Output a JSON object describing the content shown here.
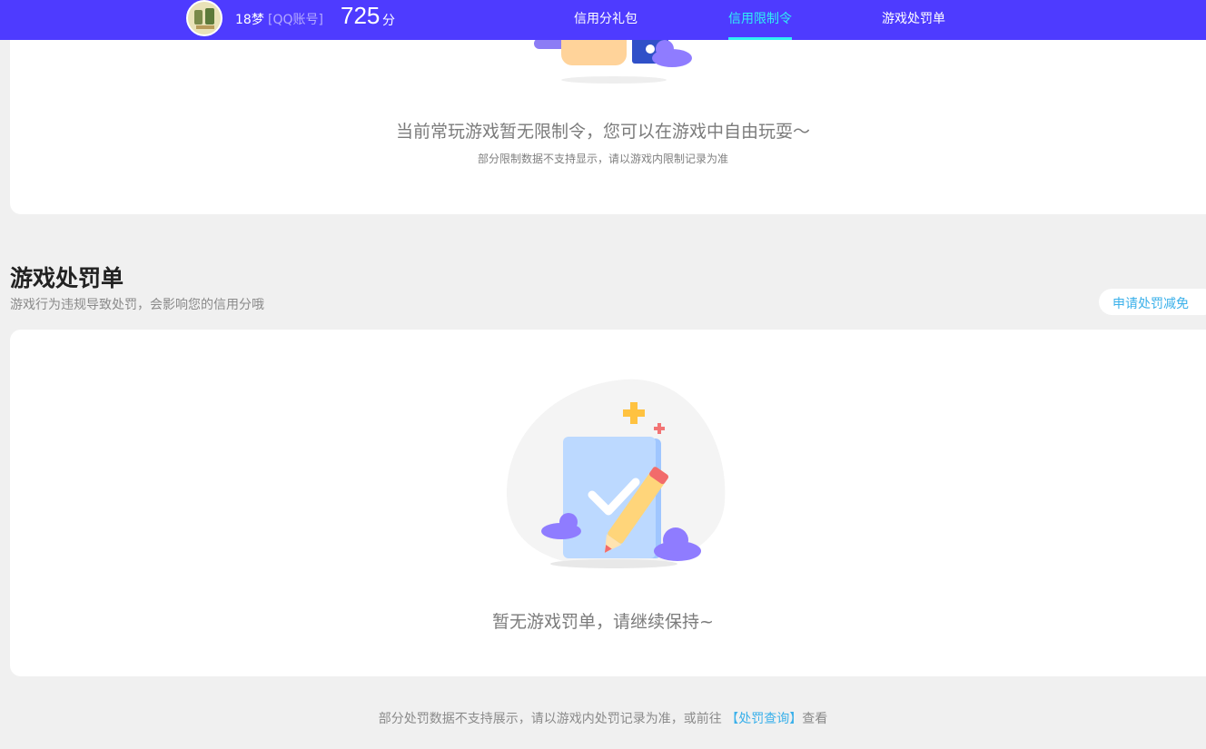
{
  "header": {
    "username": "18梦",
    "account_type": "[QQ账号]",
    "score": "725",
    "score_unit": "分",
    "tabs": [
      {
        "label": "信用分礼包",
        "active": false
      },
      {
        "label": "信用限制令",
        "active": true
      },
      {
        "label": "游戏处罚单",
        "active": false
      }
    ]
  },
  "restriction": {
    "message": "当前常玩游戏暂无限制令，您可以在游戏中自由玩耍～",
    "note": "部分限制数据不支持显示，请以游戏内限制记录为准"
  },
  "penalty": {
    "title": "游戏处罚单",
    "subtitle": "游戏行为违规导致处罚，会影响您的信用分哦",
    "appeal_button": "申请处罚减免",
    "empty_message": "暂无游戏罚单，请继续保持~"
  },
  "footer": {
    "note_prefix": "部分处罚数据不支持展示，请以游戏内处罚记录为准，或前往",
    "link_text": "【处罚查询】",
    "note_suffix": "查看"
  },
  "colors": {
    "header_bg": "#4e3bff",
    "active_tab": "#2ff0f4",
    "link": "#3ab0ea"
  }
}
